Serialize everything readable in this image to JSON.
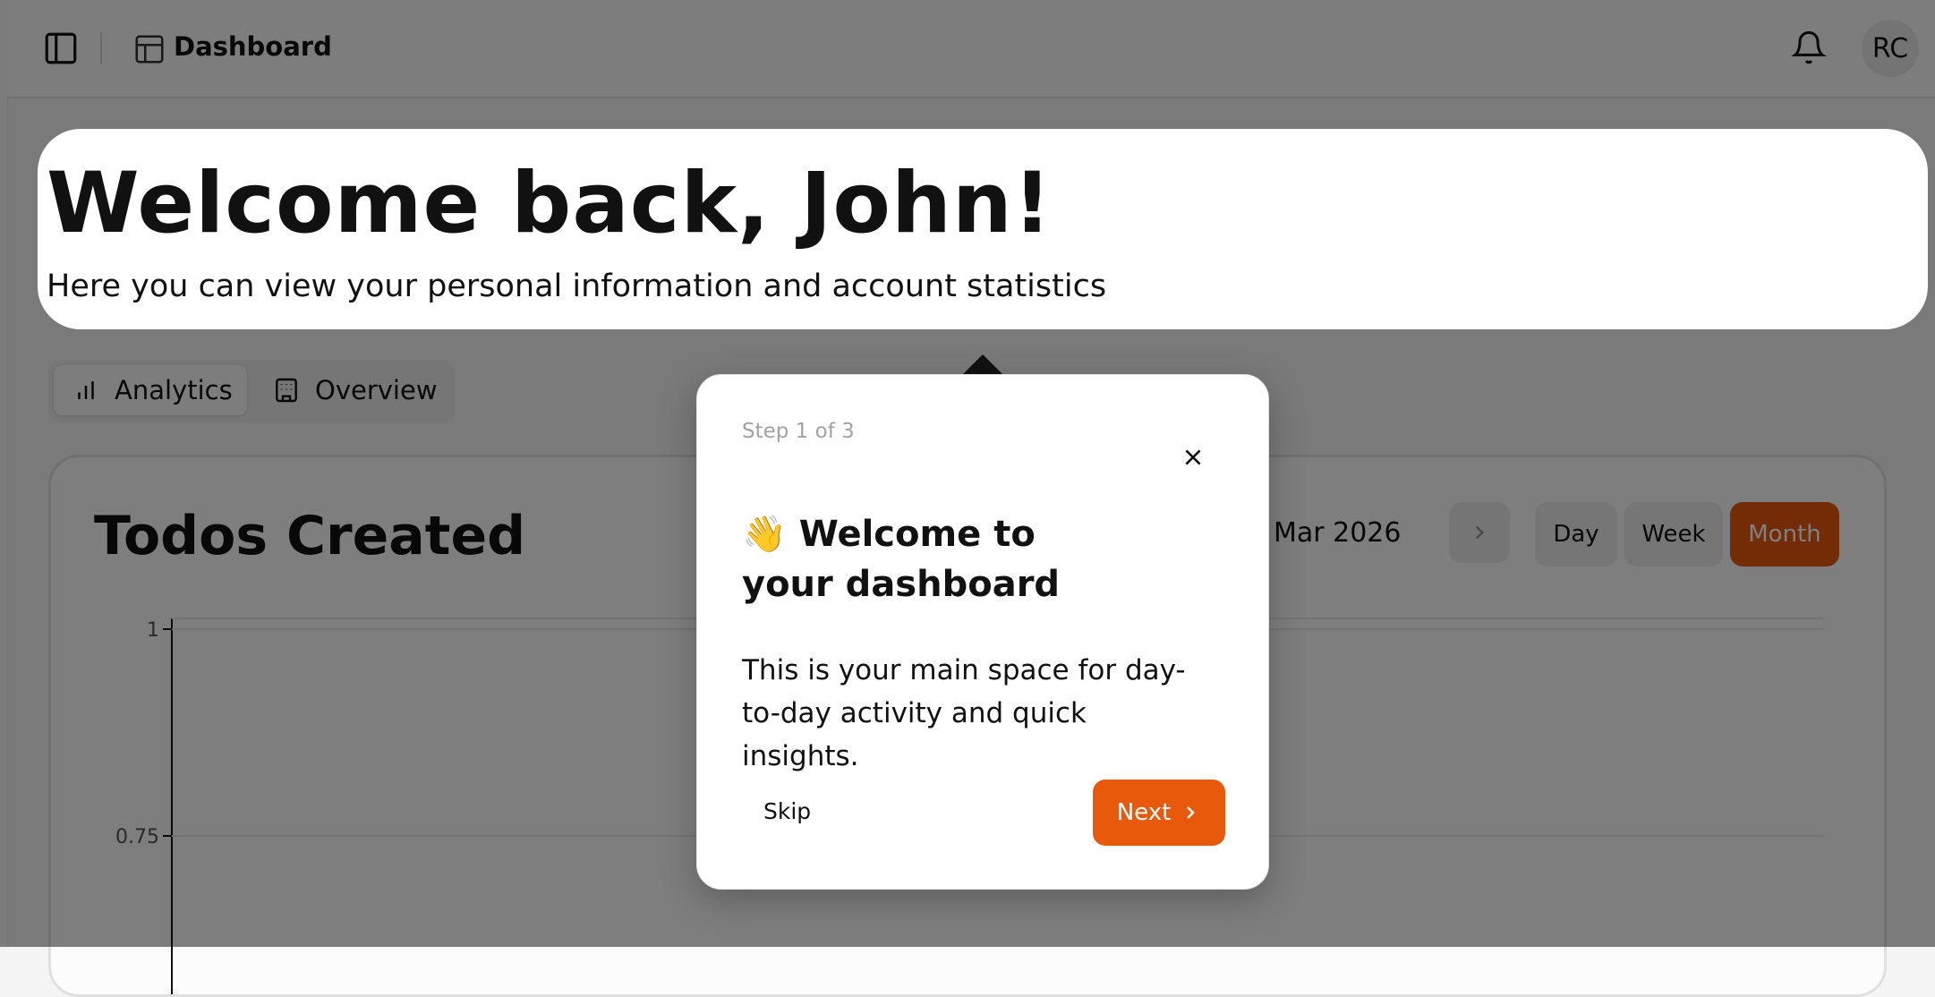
{
  "header": {
    "title": "Dashboard",
    "avatar_initials": "RC"
  },
  "welcome": {
    "heading": "Welcome back, John!",
    "subheading": "Here you can view your personal information and account statistics"
  },
  "tabs": [
    {
      "label": "Analytics",
      "icon": "bar-chart-icon",
      "active": true
    },
    {
      "label": "Overview",
      "icon": "building-icon",
      "active": false
    }
  ],
  "card": {
    "title": "Todos Created",
    "date_range": "Mar 2026",
    "ranges": [
      "Day",
      "Week",
      "Month"
    ],
    "selected_range": "Month"
  },
  "chart_data": {
    "type": "line",
    "title": "Todos Created",
    "yticks": [
      "1",
      "0.75"
    ],
    "ylim": [
      0,
      1
    ],
    "grid": true
  },
  "tour": {
    "step": "Step 1 of 3",
    "emoji": "👋",
    "title": "Welcome to your dashboard",
    "body": "This is your main space for day-to-day activity and quick insights.",
    "skip_label": "Skip",
    "next_label": "Next"
  },
  "colors": {
    "accent": "#e8590c",
    "overlay": "rgba(0,0,0,0.5)"
  }
}
